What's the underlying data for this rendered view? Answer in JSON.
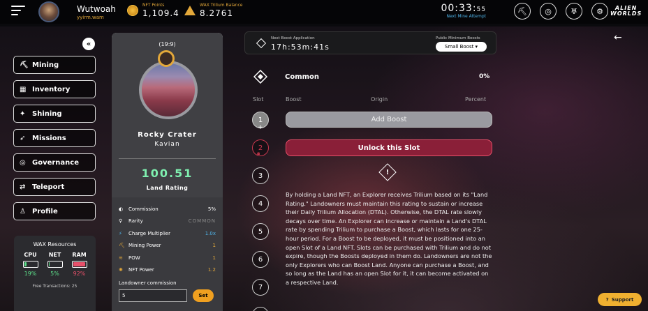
{
  "header": {
    "username": "Wutwoah",
    "wallet": "yyirm.wam",
    "nft_points_label": "NFT Points",
    "nft_points_value": "1,109.4",
    "trilium_label": "WAX Trilium Balance",
    "trilium_value": "8.2761",
    "timer_main": "00:33:",
    "timer_sec": "55",
    "timer_label": "Next Mine Attempt",
    "logo_line1": "ALIEN",
    "logo_line2": "WORLDS",
    "icons": [
      "pickaxe-icon",
      "target-icon",
      "shield-icon",
      "settings-icon"
    ]
  },
  "sidebar": {
    "collapse_glyph": "«",
    "items": [
      {
        "label": "Mining",
        "icon": "pickaxe-icon",
        "glyph": "⛏"
      },
      {
        "label": "Inventory",
        "icon": "inventory-icon",
        "glyph": "▦"
      },
      {
        "label": "Shining",
        "icon": "shining-icon",
        "glyph": "✦"
      },
      {
        "label": "Missions",
        "icon": "rocket-icon",
        "glyph": "➶"
      },
      {
        "label": "Governance",
        "icon": "governance-icon",
        "glyph": "◎"
      },
      {
        "label": "Teleport",
        "icon": "teleport-icon",
        "glyph": "⇄"
      },
      {
        "label": "Profile",
        "icon": "profile-icon",
        "glyph": "♙"
      }
    ],
    "wax_resources": {
      "title": "WAX Resources",
      "resources": [
        {
          "name": "CPU",
          "pct": "19%",
          "fill": 0.19,
          "color": "#5de08a"
        },
        {
          "name": "NET",
          "pct": "5%",
          "fill": 0.05,
          "color": "#5de08a"
        },
        {
          "name": "RAM",
          "pct": "92%",
          "fill": 0.92,
          "color": "#e8506a"
        }
      ],
      "free_tx": "Free Transactions: 25"
    }
  },
  "land": {
    "coords": "(19:9)",
    "name": "Rocky Crater",
    "planet": "Kavian",
    "rating": "100.51",
    "rating_label": "Land Rating",
    "props": [
      {
        "label": "Commission",
        "value": "5%",
        "style": "white",
        "icon": "commission-icon",
        "glyph": "◐"
      },
      {
        "label": "Rarity",
        "value": "COMMON",
        "style": "grey",
        "icon": "rarity-icon",
        "glyph": "⚲"
      },
      {
        "label": "Charge Multiplier",
        "value": "1.0x",
        "style": "blue",
        "icon": "charge-icon",
        "glyph": "⚡"
      },
      {
        "label": "Mining Power",
        "value": "1",
        "style": "gold",
        "icon": "mining-power-icon",
        "glyph": "⛏"
      },
      {
        "label": "POW",
        "value": "1",
        "style": "gold",
        "icon": "pow-icon",
        "glyph": "≋"
      },
      {
        "label": "NFT Power",
        "value": "1.2",
        "style": "gold",
        "icon": "nft-power-icon",
        "glyph": "✺"
      }
    ],
    "commission_label": "Landowner commission",
    "commission_value": "5",
    "set_label": "Set"
  },
  "boost": {
    "next_label": "Next Boost Application",
    "next_timer": "17h:53m:41s",
    "min_label": "Public Minimum Boosts",
    "min_value": "Small Boost ▾",
    "tier_name": "Common",
    "tier_pct": "0%",
    "col_slot": "Slot",
    "col_boost": "Boost",
    "col_origin": "Origin",
    "col_percent": "Percent",
    "add_boost": "Add Boost",
    "unlock_slot": "Unlock this Slot",
    "slots": [
      "1",
      "2",
      "3",
      "4",
      "5",
      "6",
      "7"
    ],
    "description": "By holding a Land NFT, an Explorer receives Trilium based on its \"Land Rating.\" Landowners must maintain this rating to sustain or increase their Daily Trilium Allocation (DTAL). Otherwise, the DTAL rate slowly decays over time. An Explorer can increase or maintain a Land's DTAL rate by spending Trilium to purchase a Boost, which lasts for one 25-hour period. For a Boost to be deployed, it must be positioned into an open Slot of a Land NFT. Slots can be purchased with Trilium and do not expire, though the Boosts deployed in them do. Landowners are not the only Explorers who can Boost Land. Anyone can purchase a Boost, and so long as the Land has an open Slot for it, it can become activated on a respective Land."
  },
  "support_label": "Support",
  "colors": {
    "gold": "#e3a83a",
    "rating_green": "#7ff0b0",
    "unlock_red": "#8a1f38",
    "accent_blue": "#4fb3e8"
  }
}
